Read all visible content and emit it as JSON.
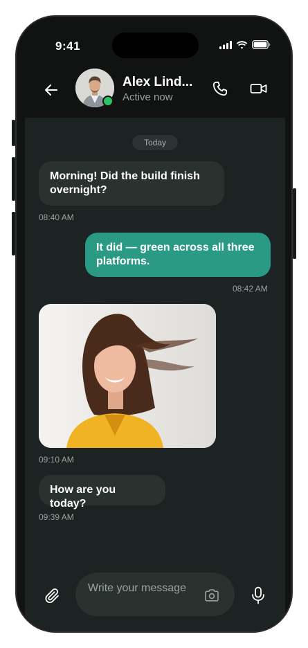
{
  "status_bar": {
    "time": "9:41"
  },
  "header": {
    "contact_name": "Alex Lind...",
    "contact_status": "Active now"
  },
  "chat": {
    "date_label": "Today",
    "messages": [
      {
        "direction": "incoming",
        "text": "Morning! Did the build finish overnight?",
        "time": "08:40 AM"
      },
      {
        "direction": "outgoing",
        "text": "It did — green across all three platforms.",
        "time": "08:42 AM"
      },
      {
        "direction": "incoming",
        "type": "image",
        "time": "09:10 AM"
      },
      {
        "direction": "incoming",
        "text": "How are you today?",
        "time": "09:39 AM"
      }
    ]
  },
  "composer": {
    "placeholder": "Write your message"
  },
  "colors": {
    "background": "#101312",
    "chat_background": "#1c2322",
    "incoming_bubble": "#29322f",
    "outgoing_bubble": "#2a9a84",
    "online": "#2ec466"
  },
  "icons": [
    "back-arrow-icon",
    "phone-icon",
    "video-camera-icon",
    "paperclip-icon",
    "camera-icon",
    "microphone-icon",
    "signal-icon",
    "wifi-icon",
    "battery-icon"
  ]
}
